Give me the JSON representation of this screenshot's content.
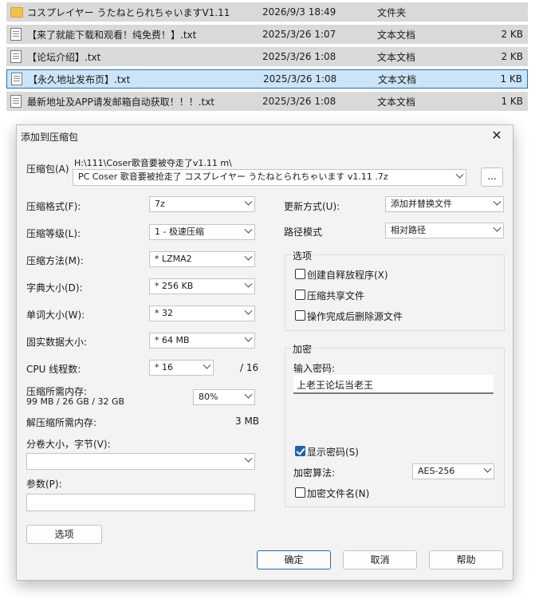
{
  "files": [
    {
      "name": "コスプレイヤー うたねとられちゃいますV1.11",
      "date": "2026/9/3 18:49",
      "type": "文件夹",
      "size": "",
      "icon": "folder-icon"
    },
    {
      "name": "【来了就能下载和观看！纯免费！】.txt",
      "date": "2025/3/26 1:07",
      "type": "文本文档",
      "size": "2 KB",
      "icon": "text-file-icon"
    },
    {
      "name": "【论坛介绍】.txt",
      "date": "2025/3/26 1:08",
      "type": "文本文档",
      "size": "2 KB",
      "icon": "text-file-icon"
    },
    {
      "name": "【永久地址发布页】.txt",
      "date": "2025/3/26 1:08",
      "type": "文本文档",
      "size": "1 KB",
      "icon": "text-file-icon"
    },
    {
      "name": "最新地址及APP请发邮箱自动获取！！！.txt",
      "date": "2025/3/26 1:08",
      "type": "文本文档",
      "size": "1 KB",
      "icon": "text-file-icon"
    }
  ],
  "dialog": {
    "title": "添加到压缩包",
    "close": "✕",
    "archive_label": "压缩包(A)",
    "archive_path": "H:\\111\\Coser歌音要被夺走了v1.11 m\\",
    "archive_name": "PC Coser 歌音要被抢走了 コスプレイヤー うたねとられちゃいます v1.11 .7z",
    "browse": "...",
    "format_label": "压缩格式(F):",
    "format_value": "7z",
    "level_label": "压缩等级(L):",
    "level_value": "1 - 极速压缩",
    "method_label": "压缩方法(M):",
    "method_value": "*  LZMA2",
    "dict_label": "字典大小(D):",
    "dict_value": "*  256 KB",
    "word_label": "单词大小(W):",
    "word_value": "*  32",
    "solid_label": "固实数据大小:",
    "solid_value": "*  64 MB",
    "threads_label": "CPU 线程数:",
    "threads_value": "*  16",
    "threads_total": "/ 16",
    "mem_label": "压缩所需内存:",
    "mem_values": "99 MB / 26 GB / 32 GB",
    "mem_percent": "80%",
    "decomp_label": "解压缩所需内存:",
    "decomp_value": "3 MB",
    "volume_label": "分卷大小，字节(V):",
    "volume_value": "",
    "params_label": "参数(P):",
    "params_value": "",
    "options_button": "选项",
    "update_label": "更新方式(U):",
    "update_value": "添加并替换文件",
    "path_label": "路径模式",
    "path_value": "相对路径",
    "options_group": "选项",
    "opt_sfx": "创建自释放程序(X)",
    "opt_shared": "压缩共享文件",
    "opt_delete": "操作完成后删除源文件",
    "enc_group": "加密",
    "pw_label": "输入密码:",
    "pw_value": "上老王论坛当老王",
    "show_pw": "显示密码(S)",
    "enc_method_label": "加密算法:",
    "enc_method_value": "AES-256",
    "enc_names": "加密文件名(N)",
    "ok": "确定",
    "cancel": "取消",
    "help": "帮助"
  },
  "colors": {
    "selected_row": "#cce4f7",
    "row": "#d9d9d9",
    "accent": "#1f5fb4"
  }
}
